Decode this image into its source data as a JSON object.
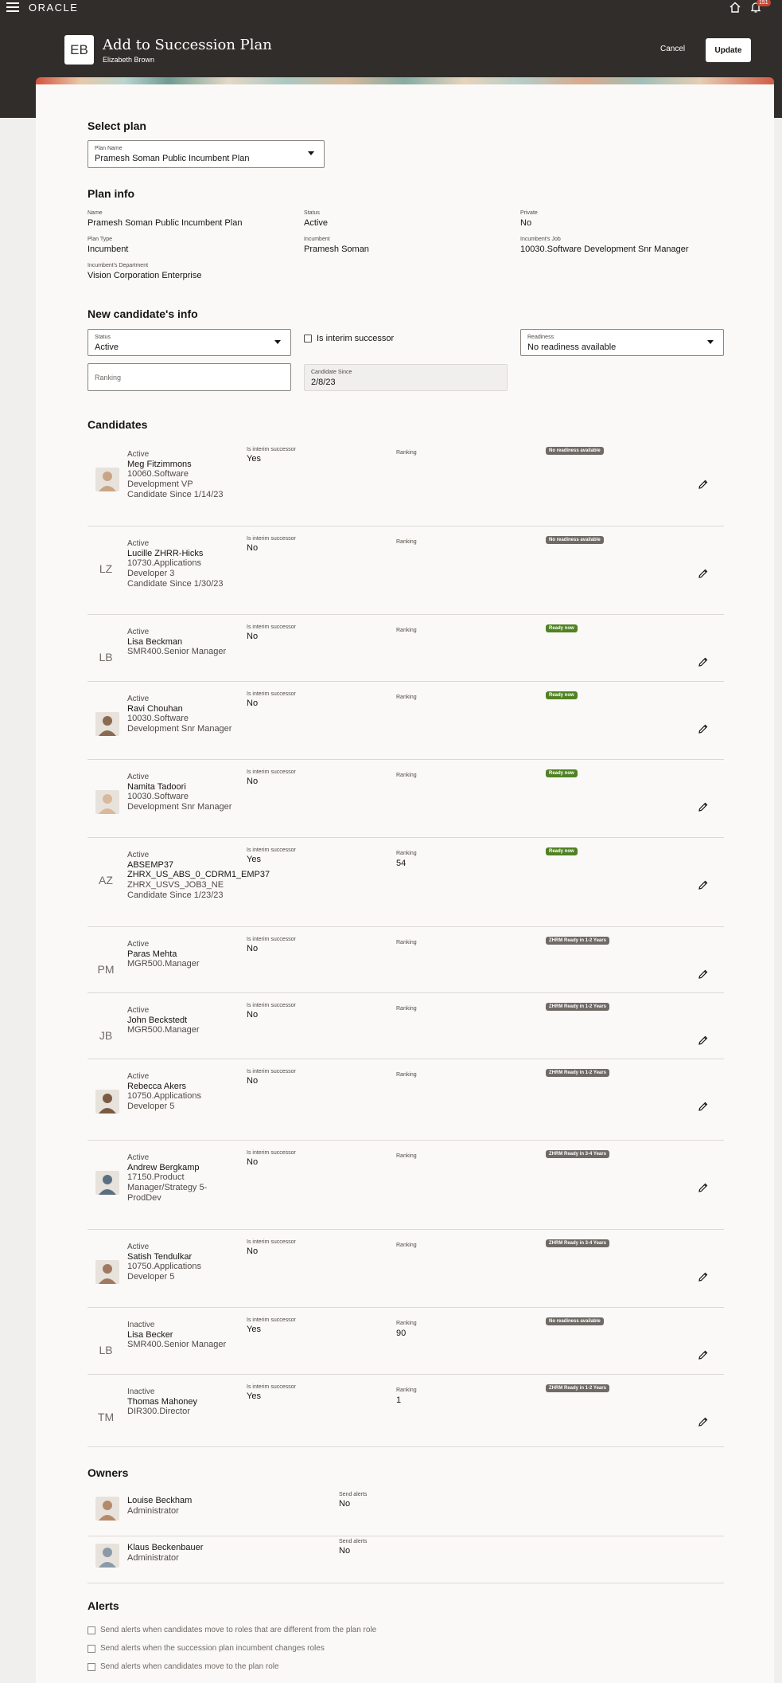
{
  "topbar": {
    "logo": "ORACLE",
    "notification_count": "151"
  },
  "header": {
    "avatar_initials": "EB",
    "title": "Add to Succession Plan",
    "subtitle": "Elizabeth Brown",
    "cancel_label": "Cancel",
    "update_label": "Update"
  },
  "select_plan": {
    "title": "Select plan",
    "label": "Plan Name",
    "value": "Pramesh Soman Public Incumbent Plan"
  },
  "plan_info": {
    "title": "Plan info",
    "name_label": "Name",
    "name_value": "Pramesh Soman Public Incumbent Plan",
    "status_label": "Status",
    "status_value": "Active",
    "private_label": "Private",
    "private_value": "No",
    "type_label": "Plan Type",
    "type_value": "Incumbent",
    "incumbent_label": "Incumbent",
    "incumbent_value": "Pramesh Soman",
    "job_label": "Incumbent's Job",
    "job_value": "10030.Software Development Snr Manager",
    "dept_label": "Incumbent's Department",
    "dept_value": "Vision Corporation Enterprise"
  },
  "new_candidate": {
    "title": "New candidate's info",
    "status_label": "Status",
    "status_value": "Active",
    "interim_label": "Is interim successor",
    "readiness_label": "Readiness",
    "readiness_value": "No readiness available",
    "ranking_placeholder": "Ranking",
    "since_label": "Candidate Since",
    "since_value": "2/8/23"
  },
  "candidates": {
    "title": "Candidates",
    "interim_label": "Is interim successor",
    "ranking_label": "Ranking",
    "rows": [
      {
        "status": "Active",
        "name": "Meg Fitzimmons",
        "job": "10060.Software Development VP",
        "since": "Candidate Since 1/14/23",
        "interim": "Yes",
        "ranking": "",
        "readiness": "No readiness available",
        "initials": ""
      },
      {
        "status": "Active",
        "name": "Lucille ZHRR-Hicks",
        "job": "10730.Applications Developer 3",
        "since": "Candidate Since 1/30/23",
        "interim": "No",
        "ranking": "",
        "readiness": "No readiness available",
        "initials": "LZ"
      },
      {
        "status": "Active",
        "name": "Lisa Beckman",
        "job": "SMR400.Senior Manager",
        "since": "",
        "interim": "No",
        "ranking": "",
        "readiness": "Ready now",
        "initials": "LB"
      },
      {
        "status": "Active",
        "name": "Ravi Chouhan",
        "job": "10030.Software Development Snr Manager",
        "since": "",
        "interim": "No",
        "ranking": "",
        "readiness": "Ready now",
        "initials": ""
      },
      {
        "status": "Active",
        "name": "Namita Tadoori",
        "job": "10030.Software Development Snr Manager",
        "since": "",
        "interim": "No",
        "ranking": "",
        "readiness": "Ready now",
        "initials": ""
      },
      {
        "status": "Active",
        "name": "ABSEMP37 ZHRX_US_ABS_0_CDRM1_EMP37",
        "job": "ZHRX_USVS_JOB3_NE",
        "since": "Candidate Since 1/23/23",
        "interim": "Yes",
        "ranking": "54",
        "readiness": "Ready now",
        "initials": "AZ"
      },
      {
        "status": "Active",
        "name": "Paras Mehta",
        "job": "MGR500.Manager",
        "since": "",
        "interim": "No",
        "ranking": "",
        "readiness": "ZHRM Ready in 1-2 Years",
        "initials": "PM"
      },
      {
        "status": "Active",
        "name": "John Beckstedt",
        "job": "MGR500.Manager",
        "since": "",
        "interim": "No",
        "ranking": "",
        "readiness": "ZHRM Ready in 1-2 Years",
        "initials": "JB"
      },
      {
        "status": "Active",
        "name": "Rebecca Akers",
        "job": "10750.Applications Developer 5",
        "since": "",
        "interim": "No",
        "ranking": "",
        "readiness": "ZHRM Ready in 1-2 Years",
        "initials": ""
      },
      {
        "status": "Active",
        "name": "Andrew Bergkamp",
        "job": "17150.Product Manager/Strategy 5-ProdDev",
        "since": "",
        "interim": "No",
        "ranking": "",
        "readiness": "ZHRM Ready in 3-4 Years",
        "initials": ""
      },
      {
        "status": "Active",
        "name": "Satish Tendulkar",
        "job": "10750.Applications Developer 5",
        "since": "",
        "interim": "No",
        "ranking": "",
        "readiness": "ZHRM Ready in 3-4 Years",
        "initials": ""
      },
      {
        "status": "Inactive",
        "name": "Lisa Becker",
        "job": "SMR400.Senior Manager",
        "since": "",
        "interim": "Yes",
        "ranking": "90",
        "readiness": "No readiness available",
        "initials": "LB"
      },
      {
        "status": "Inactive",
        "name": "Thomas Mahoney",
        "job": "DIR300.Director",
        "since": "",
        "interim": "Yes",
        "ranking": "1",
        "readiness": "ZHRM Ready in 1-2 Years",
        "initials": "TM"
      }
    ]
  },
  "owners": {
    "title": "Owners",
    "alerts_label": "Send alerts",
    "rows": [
      {
        "name": "Louise Beckham",
        "role": "Administrator",
        "alerts": "No"
      },
      {
        "name": "Klaus Beckenbauer",
        "role": "Administrator",
        "alerts": "No"
      }
    ]
  },
  "alerts": {
    "title": "Alerts",
    "options": [
      "Send alerts when candidates move to roles that are different from the plan role",
      "Send alerts when the succession plan incumbent changes roles",
      "Send alerts when candidates move to the plan role"
    ]
  },
  "colors": {
    "header_bg": "#312d2a",
    "ready_now": "#508223",
    "readiness_grey": "#6f6a65",
    "badge_red": "#c74634"
  }
}
